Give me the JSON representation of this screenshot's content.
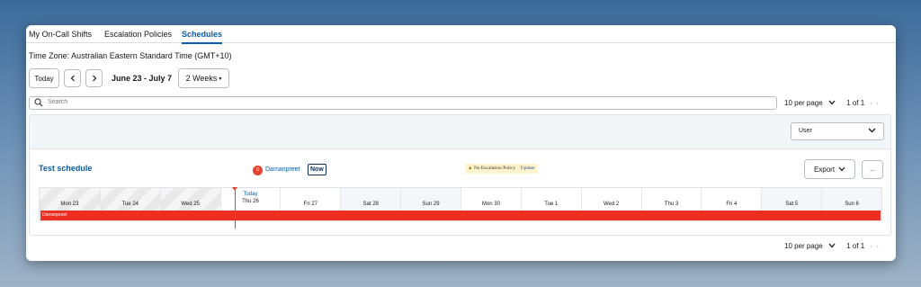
{
  "tabs": [
    {
      "label": "My On-Call Shifts"
    },
    {
      "label": "Escalation Policies"
    },
    {
      "label": "Schedules"
    }
  ],
  "active_tab": "Schedules",
  "timezone_text": "Time Zone: Australian Eastern Standard Time (GMT+10)",
  "toolbar": {
    "today_label": "Today",
    "prev_icon": "chevron-left",
    "next_icon": "chevron-right",
    "date_range": "June 23 - July 7",
    "span_label": "2 Weeks",
    "span_caret": "▾"
  },
  "search": {
    "placeholder": "Search",
    "value": ""
  },
  "pagination": {
    "per_page_label": "10 per page",
    "page_info": "1 of 1"
  },
  "filter": {
    "selected": "User"
  },
  "schedule": {
    "title": "Test schedule",
    "oncall_initial": "D",
    "oncall_name": "Damanpreet",
    "now_badge": "Now",
    "warning_text": "No Escalation Policy",
    "warning_action": "Update",
    "export_label": "Export",
    "more_label": "...",
    "days": [
      {
        "label": "Mon 23",
        "past": true
      },
      {
        "label": "Tue 24",
        "past": true
      },
      {
        "label": "Wed 25",
        "past": true
      },
      {
        "label": "Thu 26",
        "today": true
      },
      {
        "label": "Fri 27"
      },
      {
        "label": "Sat 28",
        "weekend": true
      },
      {
        "label": "Sun 29",
        "weekend": true
      },
      {
        "label": "Mon 30"
      },
      {
        "label": "Tue 1"
      },
      {
        "label": "Wed 2"
      },
      {
        "label": "Thu 3"
      },
      {
        "label": "Fri 4"
      },
      {
        "label": "Sat 5",
        "weekend": true
      },
      {
        "label": "Sun 6",
        "weekend": true
      }
    ],
    "today_label": "Today",
    "shift": {
      "user": "Damanpreet",
      "color": "#ef2e22"
    }
  },
  "colors": {
    "accent": "#0b5cab",
    "shift": "#ef2e22",
    "warning_bg": "#fff3cd"
  }
}
